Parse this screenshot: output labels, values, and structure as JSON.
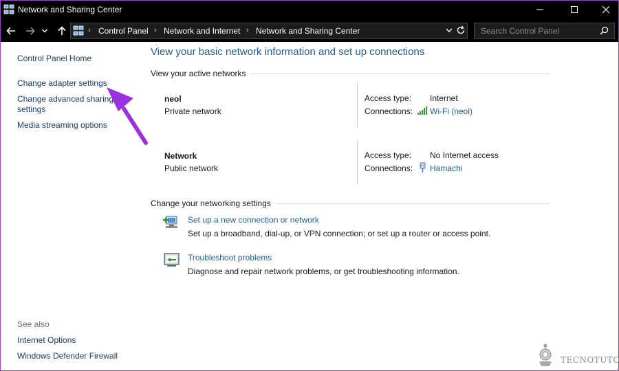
{
  "window": {
    "title": "Network and Sharing Center"
  },
  "address_bar": {
    "crumbs": [
      "Control Panel",
      "Network and Internet",
      "Network and Sharing Center"
    ]
  },
  "search": {
    "placeholder": "Search Control Panel"
  },
  "sidebar": {
    "links": [
      "Control Panel Home",
      "Change adapter settings",
      "Change advanced sharing",
      "settings",
      "Media streaming options"
    ],
    "see_also_label": "See also",
    "see_also_links": [
      "Internet Options",
      "Windows Defender Firewall"
    ]
  },
  "main": {
    "heading": "View your basic network information and set up connections",
    "active_label": "View your active networks",
    "networks": [
      {
        "name": "neol",
        "category": "Private network",
        "access_label": "Access type:",
        "access_value": "Internet",
        "connections_label": "Connections:",
        "connection": "Wi-Fi (neol)",
        "connection_icon": "wifi-signal-icon"
      },
      {
        "name": "Network",
        "category": "Public network",
        "access_label": "Access type:",
        "access_value": "No Internet access",
        "connections_label": "Connections:",
        "connection": "Hamachi",
        "connection_icon": "ethernet-plug-icon"
      }
    ],
    "change_label": "Change your networking settings",
    "tasks": [
      {
        "link": "Set up a new connection or network",
        "description": "Set up a broadband, dial-up, or VPN connection; or set up a router or access point.",
        "icon": "new-connection-icon"
      },
      {
        "link": "Troubleshoot problems",
        "description": "Diagnose and repair network problems, or get troubleshooting information.",
        "icon": "troubleshoot-icon"
      }
    ]
  },
  "watermark": {
    "text": "TECNOTUTO"
  },
  "colors": {
    "accent_link": "#1e5ea8",
    "heading": "#1e5a99",
    "annotation_arrow": "#9b30e0"
  }
}
